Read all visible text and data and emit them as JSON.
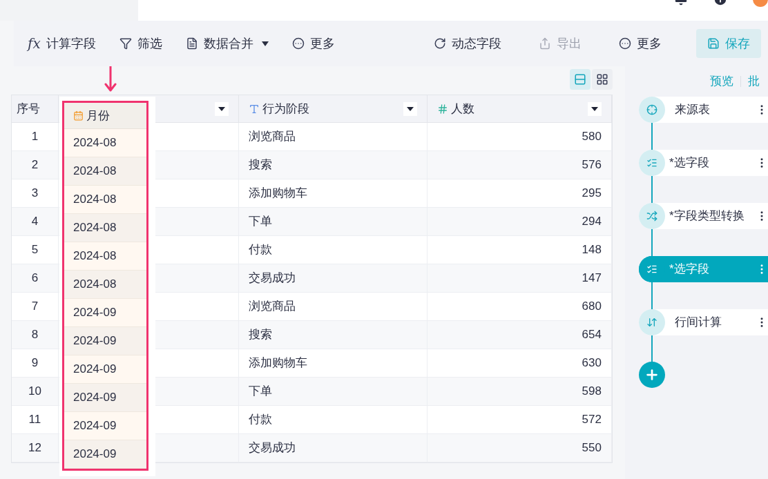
{
  "toolbar_left": [
    {
      "kind": "fx",
      "icon_text": "fx",
      "label": "计算字段"
    },
    {
      "kind": "filter",
      "label": "筛选"
    },
    {
      "kind": "merge",
      "label": "数据合并",
      "dropdown": true
    },
    {
      "kind": "more",
      "label": "更多"
    }
  ],
  "toolbar_right": [
    {
      "kind": "dynamic",
      "label": "动态字段",
      "disabled": false
    },
    {
      "kind": "export",
      "label": "导出",
      "disabled": true
    },
    {
      "kind": "more",
      "label": "更多",
      "disabled": false
    },
    {
      "kind": "save",
      "label": "保存",
      "disabled": false
    }
  ],
  "view_toggle": [
    {
      "kind": "rows",
      "selected": true
    },
    {
      "kind": "grid",
      "selected": false
    }
  ],
  "table": {
    "columns": [
      {
        "kind": "index",
        "label": "序号"
      },
      {
        "kind": "date",
        "label": "月份",
        "dragging": true
      },
      {
        "kind": "text",
        "label": "行为阶段"
      },
      {
        "kind": "number",
        "label": "人数"
      }
    ],
    "rows": [
      [
        "1",
        "2024-08",
        "浏览商品",
        "580"
      ],
      [
        "2",
        "2024-08",
        "搜索",
        "576"
      ],
      [
        "3",
        "2024-08",
        "添加购物车",
        "295"
      ],
      [
        "4",
        "2024-08",
        "下单",
        "294"
      ],
      [
        "5",
        "2024-08",
        "付款",
        "148"
      ],
      [
        "6",
        "2024-08",
        "交易成功",
        "147"
      ],
      [
        "7",
        "2024-09",
        "浏览商品",
        "680"
      ],
      [
        "8",
        "2024-09",
        "搜索",
        "654"
      ],
      [
        "9",
        "2024-09",
        "添加购物车",
        "630"
      ],
      [
        "10",
        "2024-09",
        "下单",
        "598"
      ],
      [
        "11",
        "2024-09",
        "付款",
        "572"
      ],
      [
        "12",
        "2024-09",
        "交易成功",
        "550"
      ]
    ]
  },
  "side_panel": {
    "links": [
      "预览",
      "批"
    ],
    "steps": [
      {
        "kind": "source",
        "label": "来源表",
        "selected": false
      },
      {
        "kind": "select",
        "label": "*选字段",
        "selected": false
      },
      {
        "kind": "convert",
        "label": "*字段类型转换",
        "selected": false
      },
      {
        "kind": "select",
        "label": "*选字段",
        "selected": true
      },
      {
        "kind": "rowcalc",
        "label": "行间计算",
        "selected": false
      }
    ]
  }
}
